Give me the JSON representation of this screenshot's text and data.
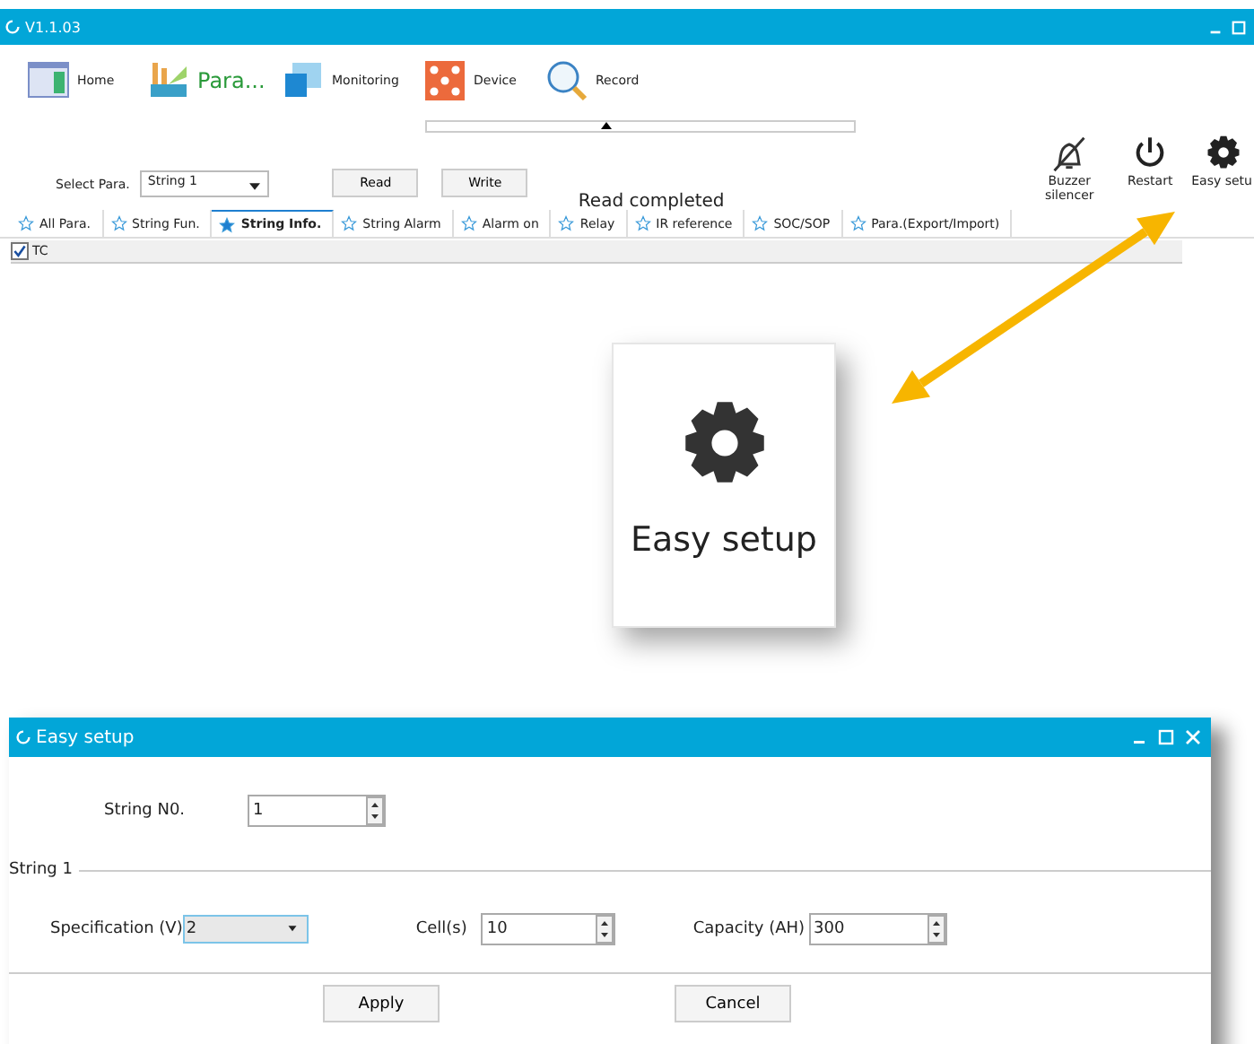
{
  "main_window": {
    "title": "V1.1.03",
    "nav": [
      {
        "kind": "home",
        "label": "Home",
        "selected": false
      },
      {
        "kind": "para",
        "label": "Para...",
        "selected": true
      },
      {
        "kind": "monitoring",
        "label": "Monitoring",
        "selected": false
      },
      {
        "kind": "device",
        "label": "Device",
        "selected": false
      },
      {
        "kind": "record",
        "label": "Record",
        "selected": false
      }
    ],
    "select": {
      "label": "Select Para.",
      "value": "String 1"
    },
    "buttons": [
      "Read",
      "Write"
    ],
    "status": "Read completed",
    "tools": [
      {
        "kind": "buzzer",
        "label": "Buzzer silencer"
      },
      {
        "kind": "restart",
        "label": "Restart"
      },
      {
        "kind": "setup",
        "label": "Easy setu"
      }
    ],
    "tabs": [
      {
        "label": "All Para.",
        "selected": false
      },
      {
        "label": "String Fun.",
        "selected": false
      },
      {
        "label": "String Info.",
        "selected": true
      },
      {
        "label": "String Alarm",
        "selected": false
      },
      {
        "label": "Alarm on",
        "selected": false
      },
      {
        "label": "Relay",
        "selected": false
      },
      {
        "label": "IR reference",
        "selected": false
      },
      {
        "label": "SOC/SOP",
        "selected": false
      },
      {
        "label": "Para.(Export/Import)",
        "selected": false
      }
    ],
    "tc": {
      "label": "TC",
      "checked": true
    }
  },
  "callout": {
    "label": "Easy setup"
  },
  "dialog": {
    "title": "Easy setup",
    "string_no": {
      "label": "String N0.",
      "value": "1"
    },
    "group": "String 1",
    "specification": {
      "label": "Specification (V)",
      "value": "2"
    },
    "cells": {
      "label": "Cell(s)",
      "value": "10"
    },
    "capacity": {
      "label": "Capacity (AH)",
      "value": "300"
    },
    "buttons": [
      "Apply",
      "Cancel"
    ]
  }
}
